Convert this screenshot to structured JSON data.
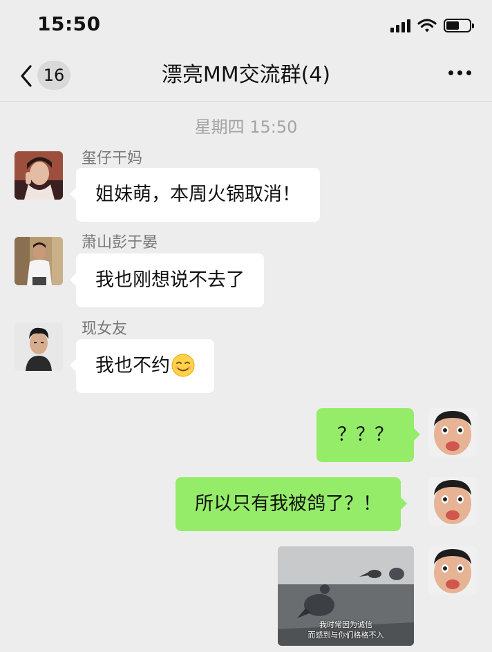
{
  "status_bar": {
    "time": "15:50"
  },
  "nav": {
    "unread_count": "16",
    "title": "漂亮MM交流群(4)"
  },
  "chat": {
    "timestamp": "星期四 15:50",
    "messages": [
      {
        "sender": "玺仔干妈",
        "text": "姐妹萌，本周火锅取消！"
      },
      {
        "sender": "萧山彭于晏",
        "text": "我也刚想说不去了"
      },
      {
        "sender": "现女友",
        "text": "我也不约"
      },
      {
        "text": "？？？"
      },
      {
        "text": "所以只有我被鸽了？！"
      },
      {
        "image_caption": [
          "我时常因为诚信",
          "而感到与你们格格不入"
        ]
      }
    ]
  },
  "colors": {
    "background": "#ededed",
    "outgoing_bubble": "#95ec69",
    "incoming_bubble": "#ffffff"
  },
  "icons": [
    "back-chevron-icon",
    "more-options-icon",
    "signal-icon",
    "wifi-icon",
    "battery-icon",
    "smiling-emoji-icon"
  ]
}
